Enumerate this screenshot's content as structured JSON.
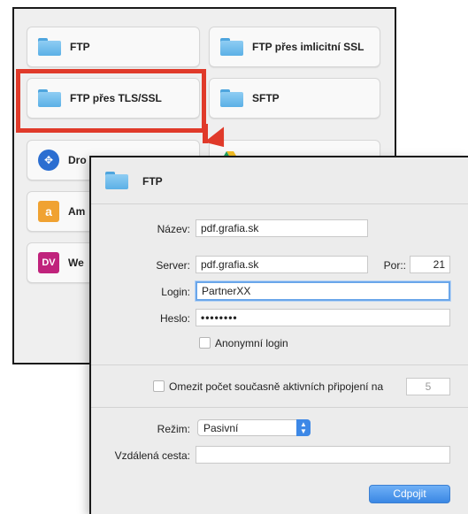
{
  "connection_types": [
    {
      "label": "FTP",
      "icon": "folder-icon"
    },
    {
      "label": "FTP přes imlicitní SSL",
      "icon": "folder-icon"
    },
    {
      "label": "FTP přes TLS/SSL",
      "icon": "folder-icon"
    },
    {
      "label": "SFTP",
      "icon": "folder-icon"
    },
    {
      "label": "Dro",
      "icon": "dropbox-icon"
    },
    {
      "label": "Am",
      "icon": "amazon-icon"
    },
    {
      "label": "We",
      "icon": "webdav-icon"
    }
  ],
  "icons": {
    "amazon_glyph": "a",
    "webdav_glyph": "DV",
    "dropbox_glyph": "✥"
  },
  "colors": {
    "highlight": "#e03a2a",
    "accent": "#3d88e6",
    "folder": "#5bb0e6"
  },
  "dialog": {
    "title": "FTP",
    "name_label": "Název:",
    "name_value": "pdf.grafia.sk",
    "server_label": "Server:",
    "server_value": "pdf.grafia.sk",
    "port_label": "Por::",
    "port_value": "21",
    "login_label": "Login:",
    "login_value": "PartnerXX",
    "password_label": "Heslo:",
    "password_value": "••••••••",
    "anon_label": "Anonymní login",
    "limit_label": "Omezit počet současně aktivních připojení na",
    "limit_value": "5",
    "mode_label": "Režim:",
    "mode_value": "Pasivní",
    "remote_path_label": "Vzdálená cesta:",
    "remote_path_value": "",
    "connect_button": "Cdpojit"
  }
}
